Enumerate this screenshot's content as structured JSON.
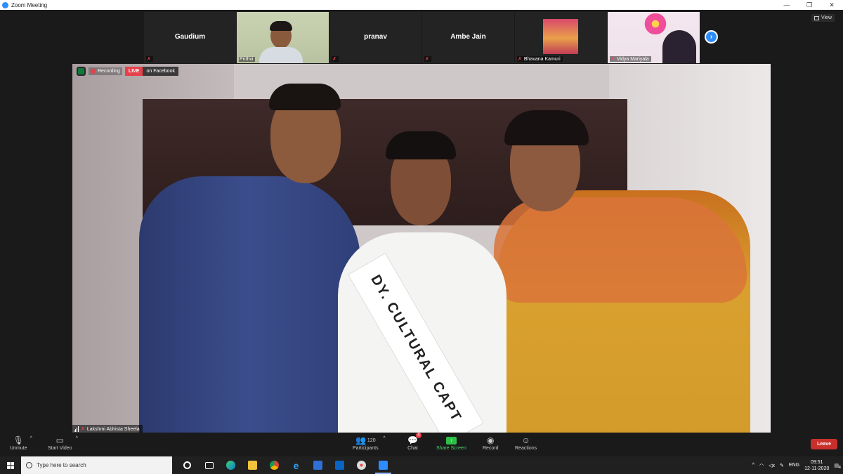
{
  "window": {
    "title": "Zoom Meeting",
    "controls": [
      "—",
      "❐",
      "✕"
    ]
  },
  "view_button": {
    "label": "View"
  },
  "thumbnails": [
    {
      "name": "Gaudium",
      "label": "",
      "type": "name"
    },
    {
      "name": "",
      "label": "Prithvi",
      "type": "video"
    },
    {
      "name": "pranav",
      "label": "",
      "type": "name"
    },
    {
      "name": "Ambe Jain",
      "label": "",
      "type": "name"
    },
    {
      "name": "",
      "label": "Bhavana Kamuri",
      "type": "photo"
    },
    {
      "name": "",
      "label": "Vidya Mariyala",
      "type": "video"
    }
  ],
  "main_video": {
    "recording_label": "Recording",
    "live_tag": "LIVE",
    "live_destination": "on Facebook",
    "speaker_name": "Lakshmi Abhista Sheela",
    "sash_text": "DY. CULTURAL CAPT"
  },
  "toolbar": {
    "unmute": "Unmute",
    "start_video": "Start Video",
    "participants_label": "Participants",
    "participants_count": "120",
    "chat": "Chat",
    "chat_badge": "4",
    "share_screen": "Share Screen",
    "record": "Record",
    "reactions": "Reactions",
    "leave": "Leave"
  },
  "taskbar": {
    "search_placeholder": "Type here to search",
    "language": "ENG",
    "time": "09:51",
    "date": "12-11-2020",
    "notification_count": "4"
  },
  "colors": {
    "accent": "#2d8cff",
    "live_red": "#e8404a",
    "share_green": "#2dbf47",
    "leave_red": "#c9302c"
  }
}
